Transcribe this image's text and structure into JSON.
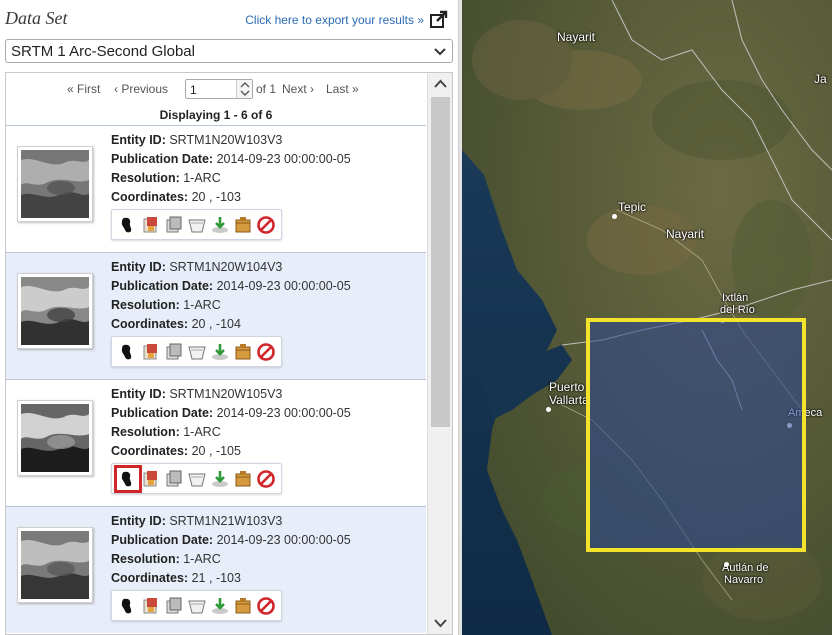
{
  "header": {
    "title": "Data Set",
    "export_link": "Click here to export your results »"
  },
  "dataset": {
    "selected": "SRTM 1 Arc-Second Global"
  },
  "pager": {
    "first": "« First",
    "previous": "‹ Previous",
    "page_value": "1",
    "of": "of 1",
    "next": "Next ›",
    "last": "Last »",
    "displaying": "Displaying 1 - 6 of 6"
  },
  "labels": {
    "entity": "Entity ID:",
    "pubdate": "Publication Date:",
    "resolution": "Resolution:",
    "coords": "Coordinates:"
  },
  "results": [
    {
      "entity_id": "SRTM1N20W103V3",
      "pub_date": "2014-09-23 00:00:00-05",
      "resolution": "1-ARC",
      "coordinates": "20 , -103"
    },
    {
      "entity_id": "SRTM1N20W104V3",
      "pub_date": "2014-09-23 00:00:00-05",
      "resolution": "1-ARC",
      "coordinates": "20 , -104"
    },
    {
      "entity_id": "SRTM1N20W105V3",
      "pub_date": "2014-09-23 00:00:00-05",
      "resolution": "1-ARC",
      "coordinates": "20 , -105"
    },
    {
      "entity_id": "SRTM1N21W103V3",
      "pub_date": "2014-09-23 00:00:00-05",
      "resolution": "1-ARC",
      "coordinates": "21 , -103"
    }
  ],
  "toolbar_icons": [
    "footprint-icon",
    "overlay-icon",
    "compare-icon",
    "exclude-icon",
    "download-icon",
    "order-icon",
    "remove-icon"
  ],
  "map": {
    "labels": {
      "nayarit_top": "Nayarit",
      "tepic": "Tepic",
      "nayarit_mid": "Nayarit",
      "ixtlan1": "Ixtlán",
      "ixtlan2": "del Río",
      "puerto1": "Puerto",
      "puerto2": "Vallarta",
      "ameca": "Ameca",
      "autlan1": "Autlán de",
      "autlan2": "Navarro",
      "edge": "Ja"
    }
  },
  "colors": {
    "link": "#2c6bb5",
    "item_alt_bg": "#e8eef9",
    "selected_outline": "#d0262b",
    "footprint": "#f3e32a"
  }
}
